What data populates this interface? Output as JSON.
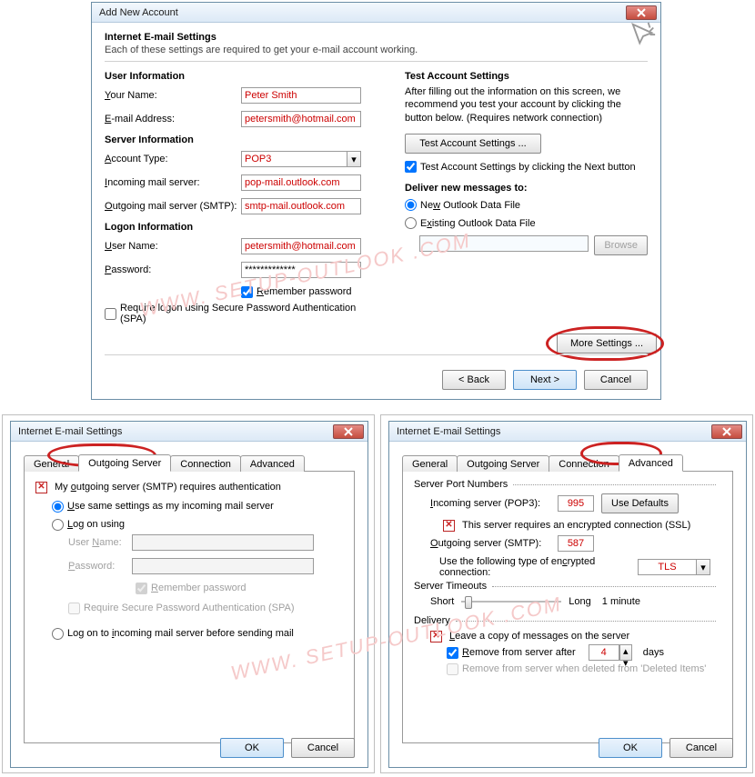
{
  "watermark": "WWW. SETUP-OUTLOOK .COM",
  "main": {
    "title": "Add New Account",
    "heading": "Internet E-mail Settings",
    "sub": "Each of these settings are required to get your e-mail account working.",
    "user_info": "User Information",
    "your_name_lbl": "Your Name:",
    "your_name_val": "Peter Smith",
    "email_lbl": "E-mail Address:",
    "email_val": "petersmith@hotmail.com",
    "server_info": "Server Information",
    "acct_type_lbl": "Account Type:",
    "acct_type_val": "POP3",
    "incoming_lbl": "Incoming mail server:",
    "incoming_val": "pop-mail.outlook.com",
    "outgoing_lbl": "Outgoing mail server (SMTP):",
    "outgoing_val": "smtp-mail.outlook.com",
    "logon_info": "Logon Information",
    "user_lbl": "User Name:",
    "user_val": "petersmith@hotmail.com",
    "pass_lbl": "Password:",
    "pass_val": "*************",
    "remember_lbl": "Remember password",
    "spa_lbl": "Require logon using Secure Password Authentication (SPA)",
    "test_hdr": "Test Account Settings",
    "test_desc": "After filling out the information on this screen, we recommend you test your account by clicking the button below. (Requires network connection)",
    "test_btn": "Test Account Settings ...",
    "test_next": "Test Account Settings by clicking the Next button",
    "deliver_hdr": "Deliver new messages to:",
    "new_pst": "New Outlook Data File",
    "existing_pst": "Existing Outlook Data File",
    "browse_btn": "Browse",
    "more_btn": "More Settings ...",
    "back_btn": "< Back",
    "next_btn": "Next >",
    "cancel_btn": "Cancel"
  },
  "dlg_out": {
    "title": "Internet E-mail Settings",
    "tabs": {
      "general": "General",
      "outgoing": "Outgoing Server",
      "connection": "Connection",
      "advanced": "Advanced"
    },
    "req_auth": "My outgoing server (SMTP) requires authentication",
    "same": "Use same settings as my incoming mail server",
    "logon": "Log on using",
    "user_lbl": "User Name:",
    "pass_lbl": "Password:",
    "remember": "Remember password",
    "spa": "Require Secure Password Authentication (SPA)",
    "before": "Log on to incoming mail server before sending mail",
    "ok": "OK",
    "cancel": "Cancel"
  },
  "dlg_adv": {
    "title": "Internet E-mail Settings",
    "tabs": {
      "general": "General",
      "outgoing": "Outgoing Server",
      "connection": "Connection",
      "advanced": "Advanced"
    },
    "ports_hdr": "Server Port Numbers",
    "incoming_lbl": "Incoming server (POP3):",
    "incoming_val": "995",
    "defaults_btn": "Use Defaults",
    "ssl": "This server requires an encrypted connection (SSL)",
    "outgoing_lbl": "Outgoing server (SMTP):",
    "outgoing_val": "587",
    "enc_lbl": "Use the following type of encrypted connection:",
    "enc_val": "TLS",
    "timeouts_hdr": "Server Timeouts",
    "short": "Short",
    "long": "Long",
    "duration": "1 minute",
    "delivery_hdr": "Delivery",
    "leave": "Leave a copy of messages on the server",
    "remove_after": "Remove from server after",
    "remove_days_val": "4",
    "remove_days_unit": "days",
    "remove_deleted": "Remove from server when deleted from 'Deleted Items'",
    "ok": "OK",
    "cancel": "Cancel"
  }
}
